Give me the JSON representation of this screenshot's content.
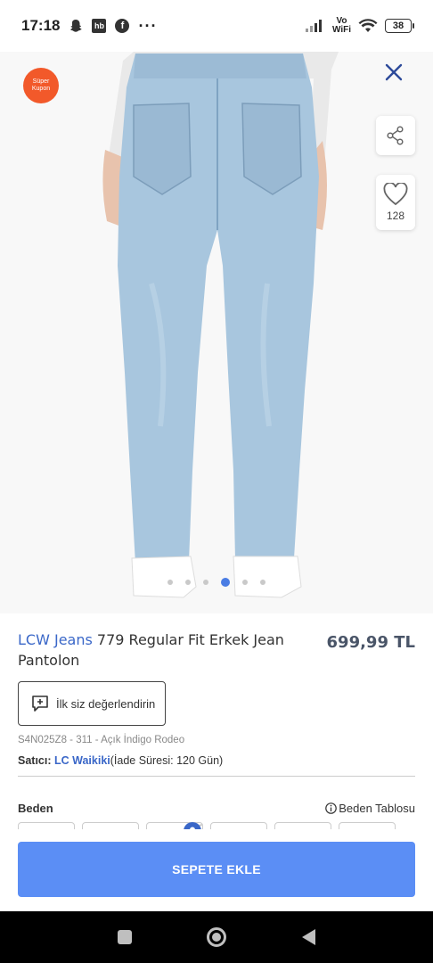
{
  "status_bar": {
    "time": "17:18",
    "hb_label": "hb",
    "fb_label": "f",
    "more": "···",
    "volte_top": "Vo",
    "volte_bottom": "WiFi",
    "battery": "38"
  },
  "gallery": {
    "coupon_line1": "Süper",
    "coupon_line2": "Kupon",
    "favorite_count": "128",
    "slide_count": 6,
    "active_slide": 4
  },
  "product": {
    "brand": "LCW Jeans",
    "name": " 779 Regular Fit Erkek Jean Pantolon",
    "price": "699,99 TL",
    "rate_label": "İlk siz değerlendirin",
    "sku": "S4N025Z8 - 311 - Açık İndigo Rodeo",
    "seller_label": "Satıcı:",
    "seller_name": "LC Waikiki",
    "return_info": "(İade Süresi: 120 Gün)"
  },
  "sizes": {
    "label": "Beden",
    "table_label": "Beden Tablosu"
  },
  "cta": {
    "add_to_cart": "SEPETE EKLE"
  },
  "colors": {
    "brand_blue": "#3a67c8",
    "cta_blue": "#5b8ef5",
    "close_blue": "#2d4a9a",
    "coupon_orange": "#f2592a"
  }
}
